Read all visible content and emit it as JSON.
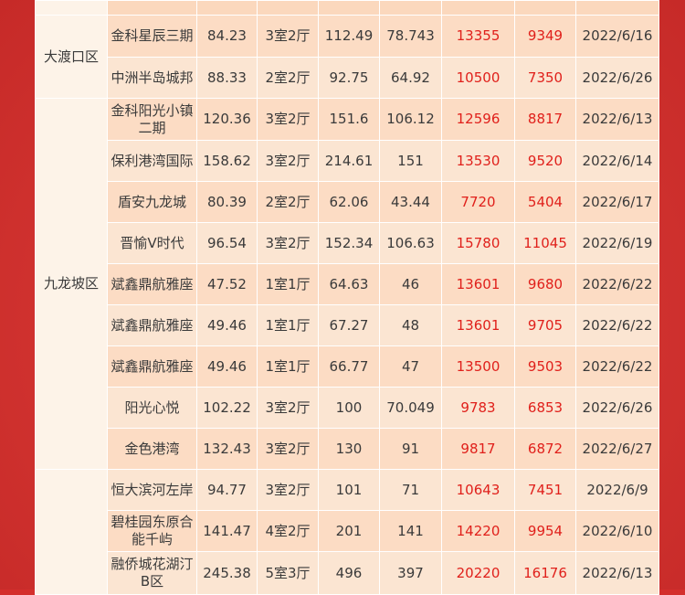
{
  "colors": {
    "background": "#d42f2c",
    "cell": "#fbe2cc",
    "district_cell": "#fdf3e8",
    "price_red": "#e0201b",
    "text": "#3a3a3a"
  },
  "groups": [
    {
      "district": "大渡口区",
      "rows": [
        {
          "name": "金科星辰三期",
          "area": "84.23",
          "layout": "3室2厅",
          "gross_area": "112.49",
          "net_area": "78.743",
          "price_inner": "13355",
          "price_gross": "9349",
          "date": "2022/6/16"
        },
        {
          "name": "中洲半岛城邦",
          "area": "88.33",
          "layout": "2室2厅",
          "gross_area": "92.75",
          "net_area": "64.92",
          "price_inner": "10500",
          "price_gross": "7350",
          "date": "2022/6/26"
        }
      ]
    },
    {
      "district": "九龙坡区",
      "rows": [
        {
          "name": "金科阳光小镇二期",
          "area": "120.36",
          "layout": "3室2厅",
          "gross_area": "151.6",
          "net_area": "106.12",
          "price_inner": "12596",
          "price_gross": "8817",
          "date": "2022/6/13"
        },
        {
          "name": "保利港湾国际",
          "area": "158.62",
          "layout": "3室2厅",
          "gross_area": "214.61",
          "net_area": "151",
          "price_inner": "13530",
          "price_gross": "9520",
          "date": "2022/6/14"
        },
        {
          "name": "盾安九龙城",
          "area": "80.39",
          "layout": "2室2厅",
          "gross_area": "62.06",
          "net_area": "43.44",
          "price_inner": "7720",
          "price_gross": "5404",
          "date": "2022/6/17"
        },
        {
          "name": "晋愉V时代",
          "area": "96.54",
          "layout": "3室2厅",
          "gross_area": "152.34",
          "net_area": "106.63",
          "price_inner": "15780",
          "price_gross": "11045",
          "date": "2022/6/19"
        },
        {
          "name": "斌鑫鼎航雅座",
          "area": "47.52",
          "layout": "1室1厅",
          "gross_area": "64.63",
          "net_area": "46",
          "price_inner": "13601",
          "price_gross": "9680",
          "date": "2022/6/22"
        },
        {
          "name": "斌鑫鼎航雅座",
          "area": "49.46",
          "layout": "1室1厅",
          "gross_area": "67.27",
          "net_area": "48",
          "price_inner": "13601",
          "price_gross": "9705",
          "date": "2022/6/22"
        },
        {
          "name": "斌鑫鼎航雅座",
          "area": "49.46",
          "layout": "1室1厅",
          "gross_area": "66.77",
          "net_area": "47",
          "price_inner": "13500",
          "price_gross": "9503",
          "date": "2022/6/22"
        },
        {
          "name": "阳光心悦",
          "area": "102.22",
          "layout": "3室2厅",
          "gross_area": "100",
          "net_area": "70.049",
          "price_inner": "9783",
          "price_gross": "6853",
          "date": "2022/6/26"
        },
        {
          "name": "金色港湾",
          "area": "132.43",
          "layout": "3室2厅",
          "gross_area": "130",
          "net_area": "91",
          "price_inner": "9817",
          "price_gross": "6872",
          "date": "2022/6/27"
        }
      ]
    },
    {
      "district": "",
      "rows": [
        {
          "name": "恒大滨河左岸",
          "area": "94.77",
          "layout": "3室2厅",
          "gross_area": "101",
          "net_area": "71",
          "price_inner": "10643",
          "price_gross": "7451",
          "date": "2022/6/9"
        },
        {
          "name": "碧桂园东原合能千屿",
          "area": "141.47",
          "layout": "4室2厅",
          "gross_area": "201",
          "net_area": "141",
          "price_inner": "14220",
          "price_gross": "9954",
          "date": "2022/6/10"
        },
        {
          "name": "融侨城花湖汀B区",
          "area": "245.38",
          "layout": "5室3厅",
          "gross_area": "496",
          "net_area": "397",
          "price_inner": "20220",
          "price_gross": "16176",
          "date": "2022/6/13"
        }
      ]
    }
  ]
}
